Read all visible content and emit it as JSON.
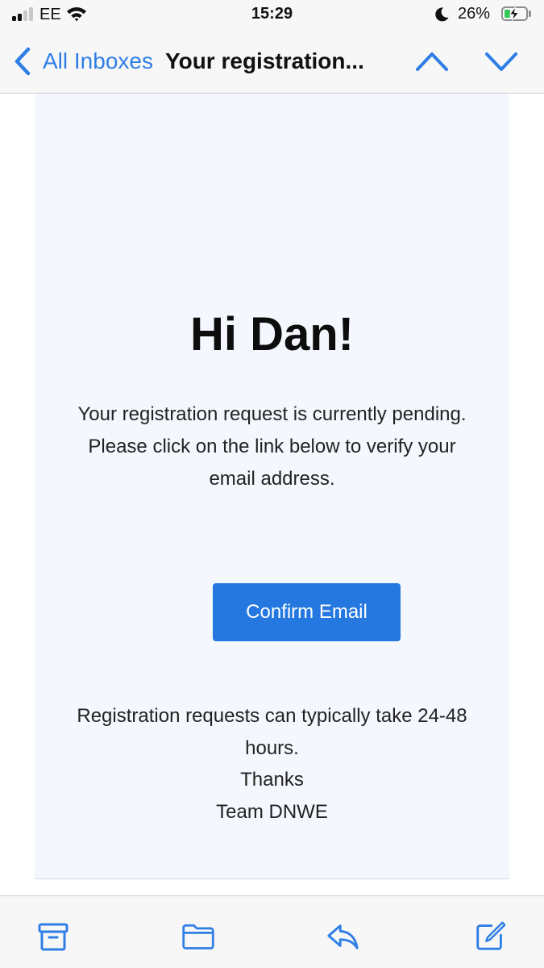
{
  "status_bar": {
    "carrier": "EE",
    "time": "15:29",
    "battery_percent": "26%",
    "battery_level": 0.26,
    "signal_bars": 2,
    "charging": true,
    "icons": [
      "signal-icon",
      "wifi-icon",
      "moon-icon",
      "battery-icon",
      "bolt-icon"
    ]
  },
  "nav": {
    "back_label": "All Inboxes",
    "subject": "Your registration...",
    "icons": [
      "chevron-left-icon",
      "chevron-up-icon",
      "chevron-down-icon"
    ]
  },
  "email": {
    "greeting": "Hi Dan!",
    "body_lines": [
      "Your registration request is currently pending.",
      "Please click on the link below to verify your email address."
    ],
    "button_label": "Confirm Email",
    "footer_lines": [
      "Registration requests can typically take 24-48 hours.",
      "Thanks",
      "Team DNWE"
    ]
  },
  "toolbar": {
    "icons": [
      "archive-icon",
      "folder-icon",
      "reply-icon",
      "compose-icon"
    ]
  },
  "colors": {
    "accent": "#2f7ee6",
    "button": "#2478e0",
    "email_background": "#f4f7fd",
    "battery_fill": "#35c759"
  }
}
